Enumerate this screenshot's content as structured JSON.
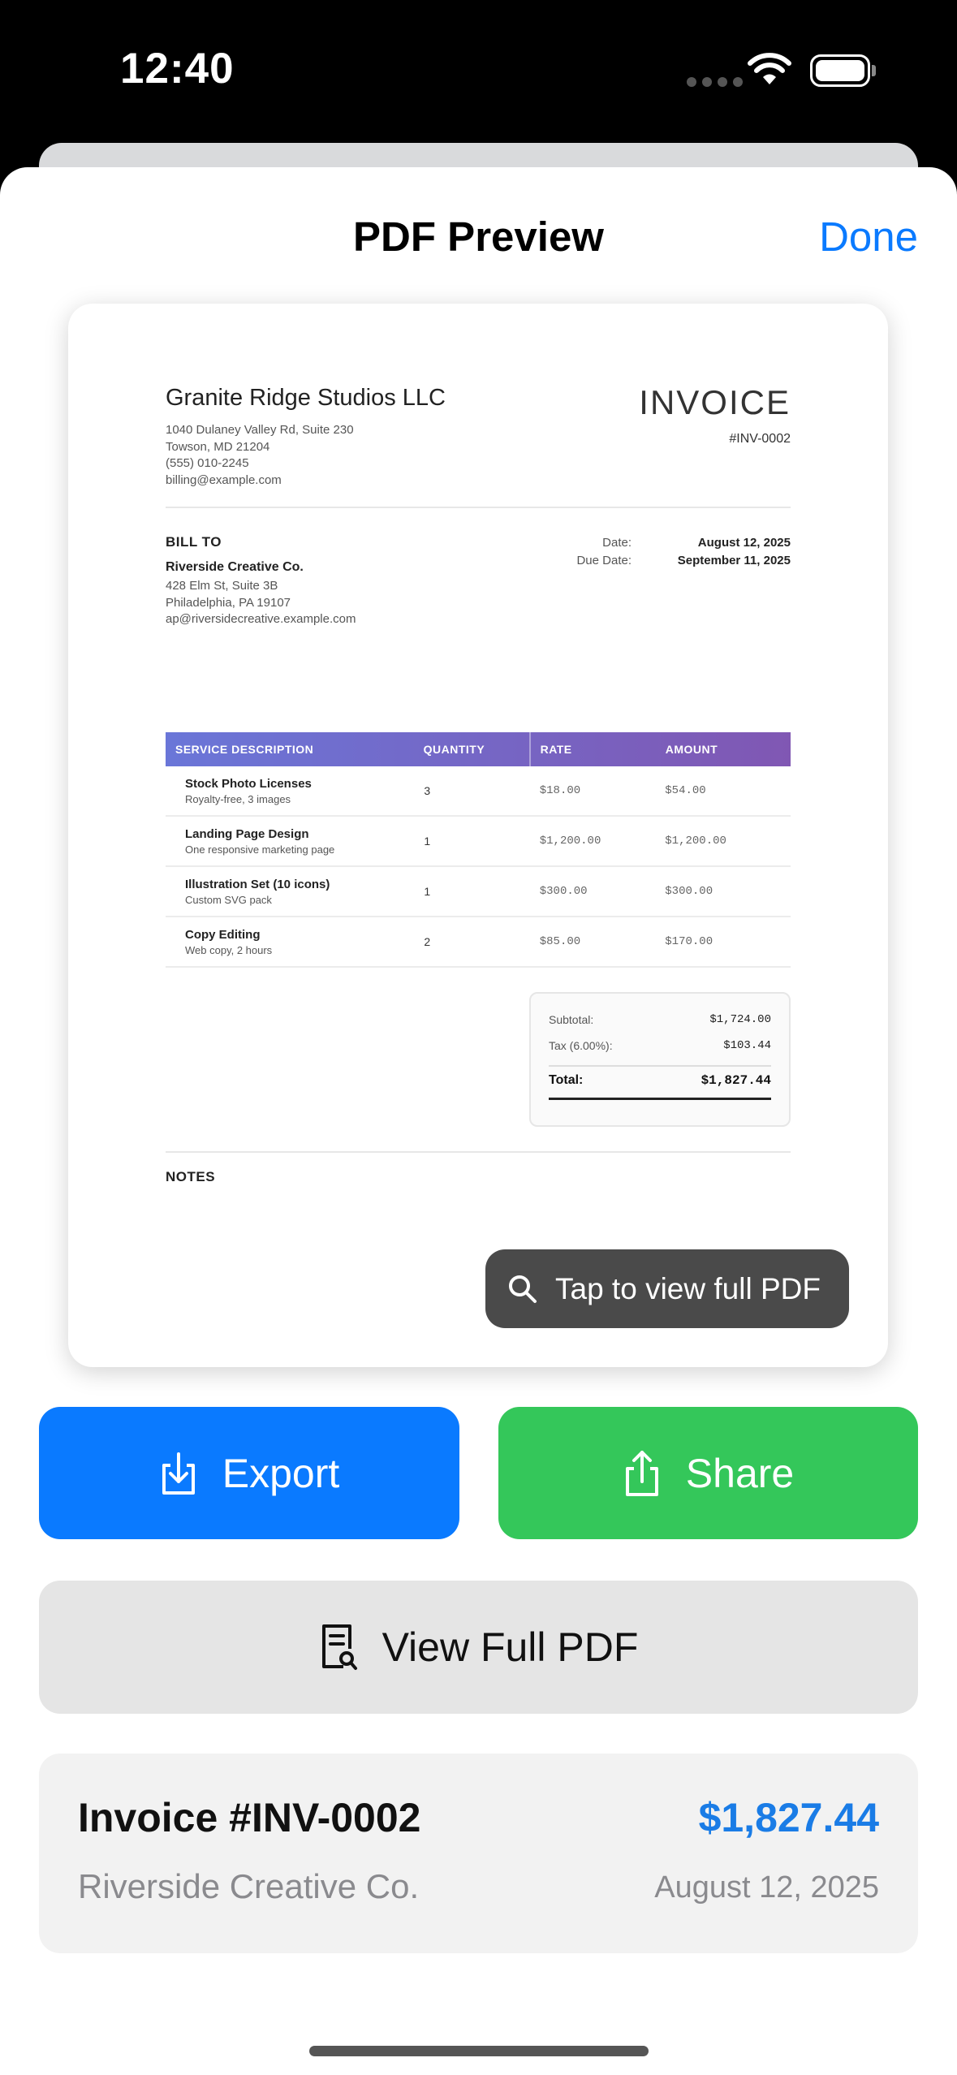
{
  "status_bar": {
    "time": "12:40"
  },
  "nav": {
    "title": "PDF Preview",
    "done": "Done"
  },
  "invoice_doc": {
    "company": "Granite Ridge Studios LLC",
    "company_lines": [
      "1040 Dulaney Valley Rd, Suite 230",
      "Towson, MD 21204",
      "(555) 010-2245",
      "billing@example.com"
    ],
    "title": "INVOICE",
    "number": "#INV-0002",
    "bill_to_heading": "BILL TO",
    "client_name": "Riverside Creative Co.",
    "client_lines": [
      "428 Elm St, Suite 3B",
      "Philadelphia, PA 19107",
      "ap@riversidecreative.example.com"
    ],
    "date_label": "Date:",
    "date_value": "August 12, 2025",
    "due_label": "Due Date:",
    "due_value": "September 11, 2025",
    "columns": [
      "SERVICE DESCRIPTION",
      "QUANTITY",
      "RATE",
      "AMOUNT"
    ],
    "rows": [
      {
        "name": "Stock Photo Licenses",
        "desc": "Royalty-free, 3 images",
        "qty": "3",
        "rate": "$18.00",
        "amount": "$54.00"
      },
      {
        "name": "Landing Page Design",
        "desc": "One responsive marketing page",
        "qty": "1",
        "rate": "$1,200.00",
        "amount": "$1,200.00"
      },
      {
        "name": "Illustration Set (10 icons)",
        "desc": "Custom SVG pack",
        "qty": "1",
        "rate": "$300.00",
        "amount": "$300.00"
      },
      {
        "name": "Copy Editing",
        "desc": "Web copy, 2 hours",
        "qty": "2",
        "rate": "$85.00",
        "amount": "$170.00"
      }
    ],
    "subtotal_label": "Subtotal:",
    "subtotal": "$1,724.00",
    "tax_label": "Tax (6.00%):",
    "tax": "$103.44",
    "total_label": "Total:",
    "total": "$1,827.44",
    "notes_heading": "NOTES"
  },
  "tap_hint": "Tap to view full PDF",
  "actions": {
    "export": "Export",
    "share": "Share",
    "view_full": "View Full PDF"
  },
  "summary": {
    "title": "Invoice #INV-0002",
    "amount": "$1,827.44",
    "client": "Riverside Creative Co.",
    "date": "August 12, 2025"
  },
  "colors": {
    "accent": "#0a7aff",
    "share": "#34c75a",
    "amount": "#1a7ce6"
  },
  "icons": [
    "wifi-icon",
    "battery-icon",
    "search-icon",
    "export-icon",
    "share-icon",
    "document-search-icon"
  ]
}
